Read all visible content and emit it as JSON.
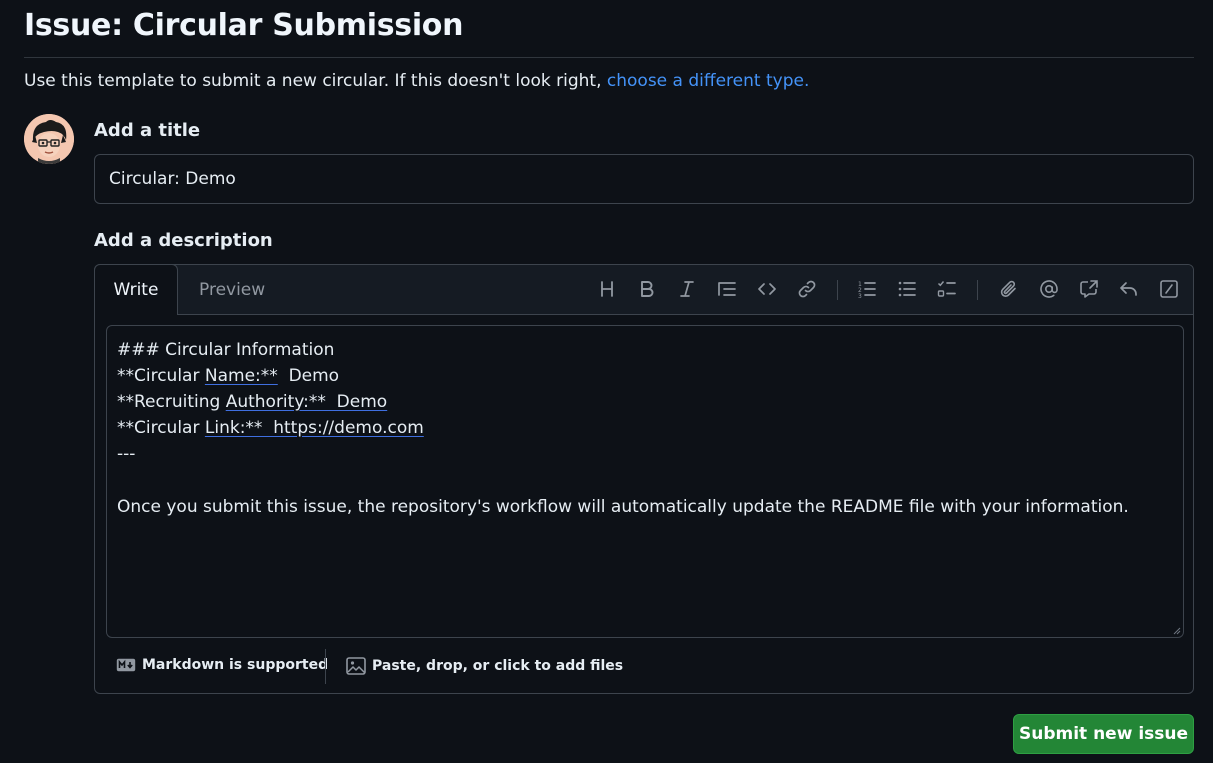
{
  "header": {
    "title": "Issue: Circular Submission",
    "intro_text": "Use this template to submit a new circular. If this doesn't look right, ",
    "intro_link": "choose a different type."
  },
  "form": {
    "title_label": "Add a title",
    "title_value": "Circular: Demo",
    "description_label": "Add a description"
  },
  "editor": {
    "tabs": [
      {
        "label": "Write",
        "active": true
      },
      {
        "label": "Preview",
        "active": false
      }
    ],
    "toolbar": [
      "heading-icon",
      "bold-icon",
      "italic-icon",
      "quote-icon",
      "code-icon",
      "link-icon",
      "numbered-list-icon",
      "bullet-list-icon",
      "task-list-icon",
      "attach-icon",
      "mention-icon",
      "cross-reference-icon",
      "reply-icon",
      "slash-command-icon"
    ],
    "body": {
      "line1": "### Circular Information",
      "line2_prefix": "**Circular ",
      "line2_ul": "Name:**",
      "line2_value": "  Demo",
      "line3_prefix": "**Recruiting ",
      "line3_ul": "Authority:**  Demo",
      "line4_prefix": "**Circular ",
      "line4_ul": "Link:**  https://demo.com",
      "line5": "---",
      "line6": "Once you submit this issue, the repository's workflow will automatically update the README file with your information."
    },
    "footer": {
      "markdown": "Markdown is supported",
      "files": "Paste, drop, or click to add files"
    }
  },
  "actions": {
    "submit": "Submit new issue"
  },
  "colors": {
    "background": "#0d1117",
    "link": "#4493f8",
    "submit": "#238636"
  }
}
